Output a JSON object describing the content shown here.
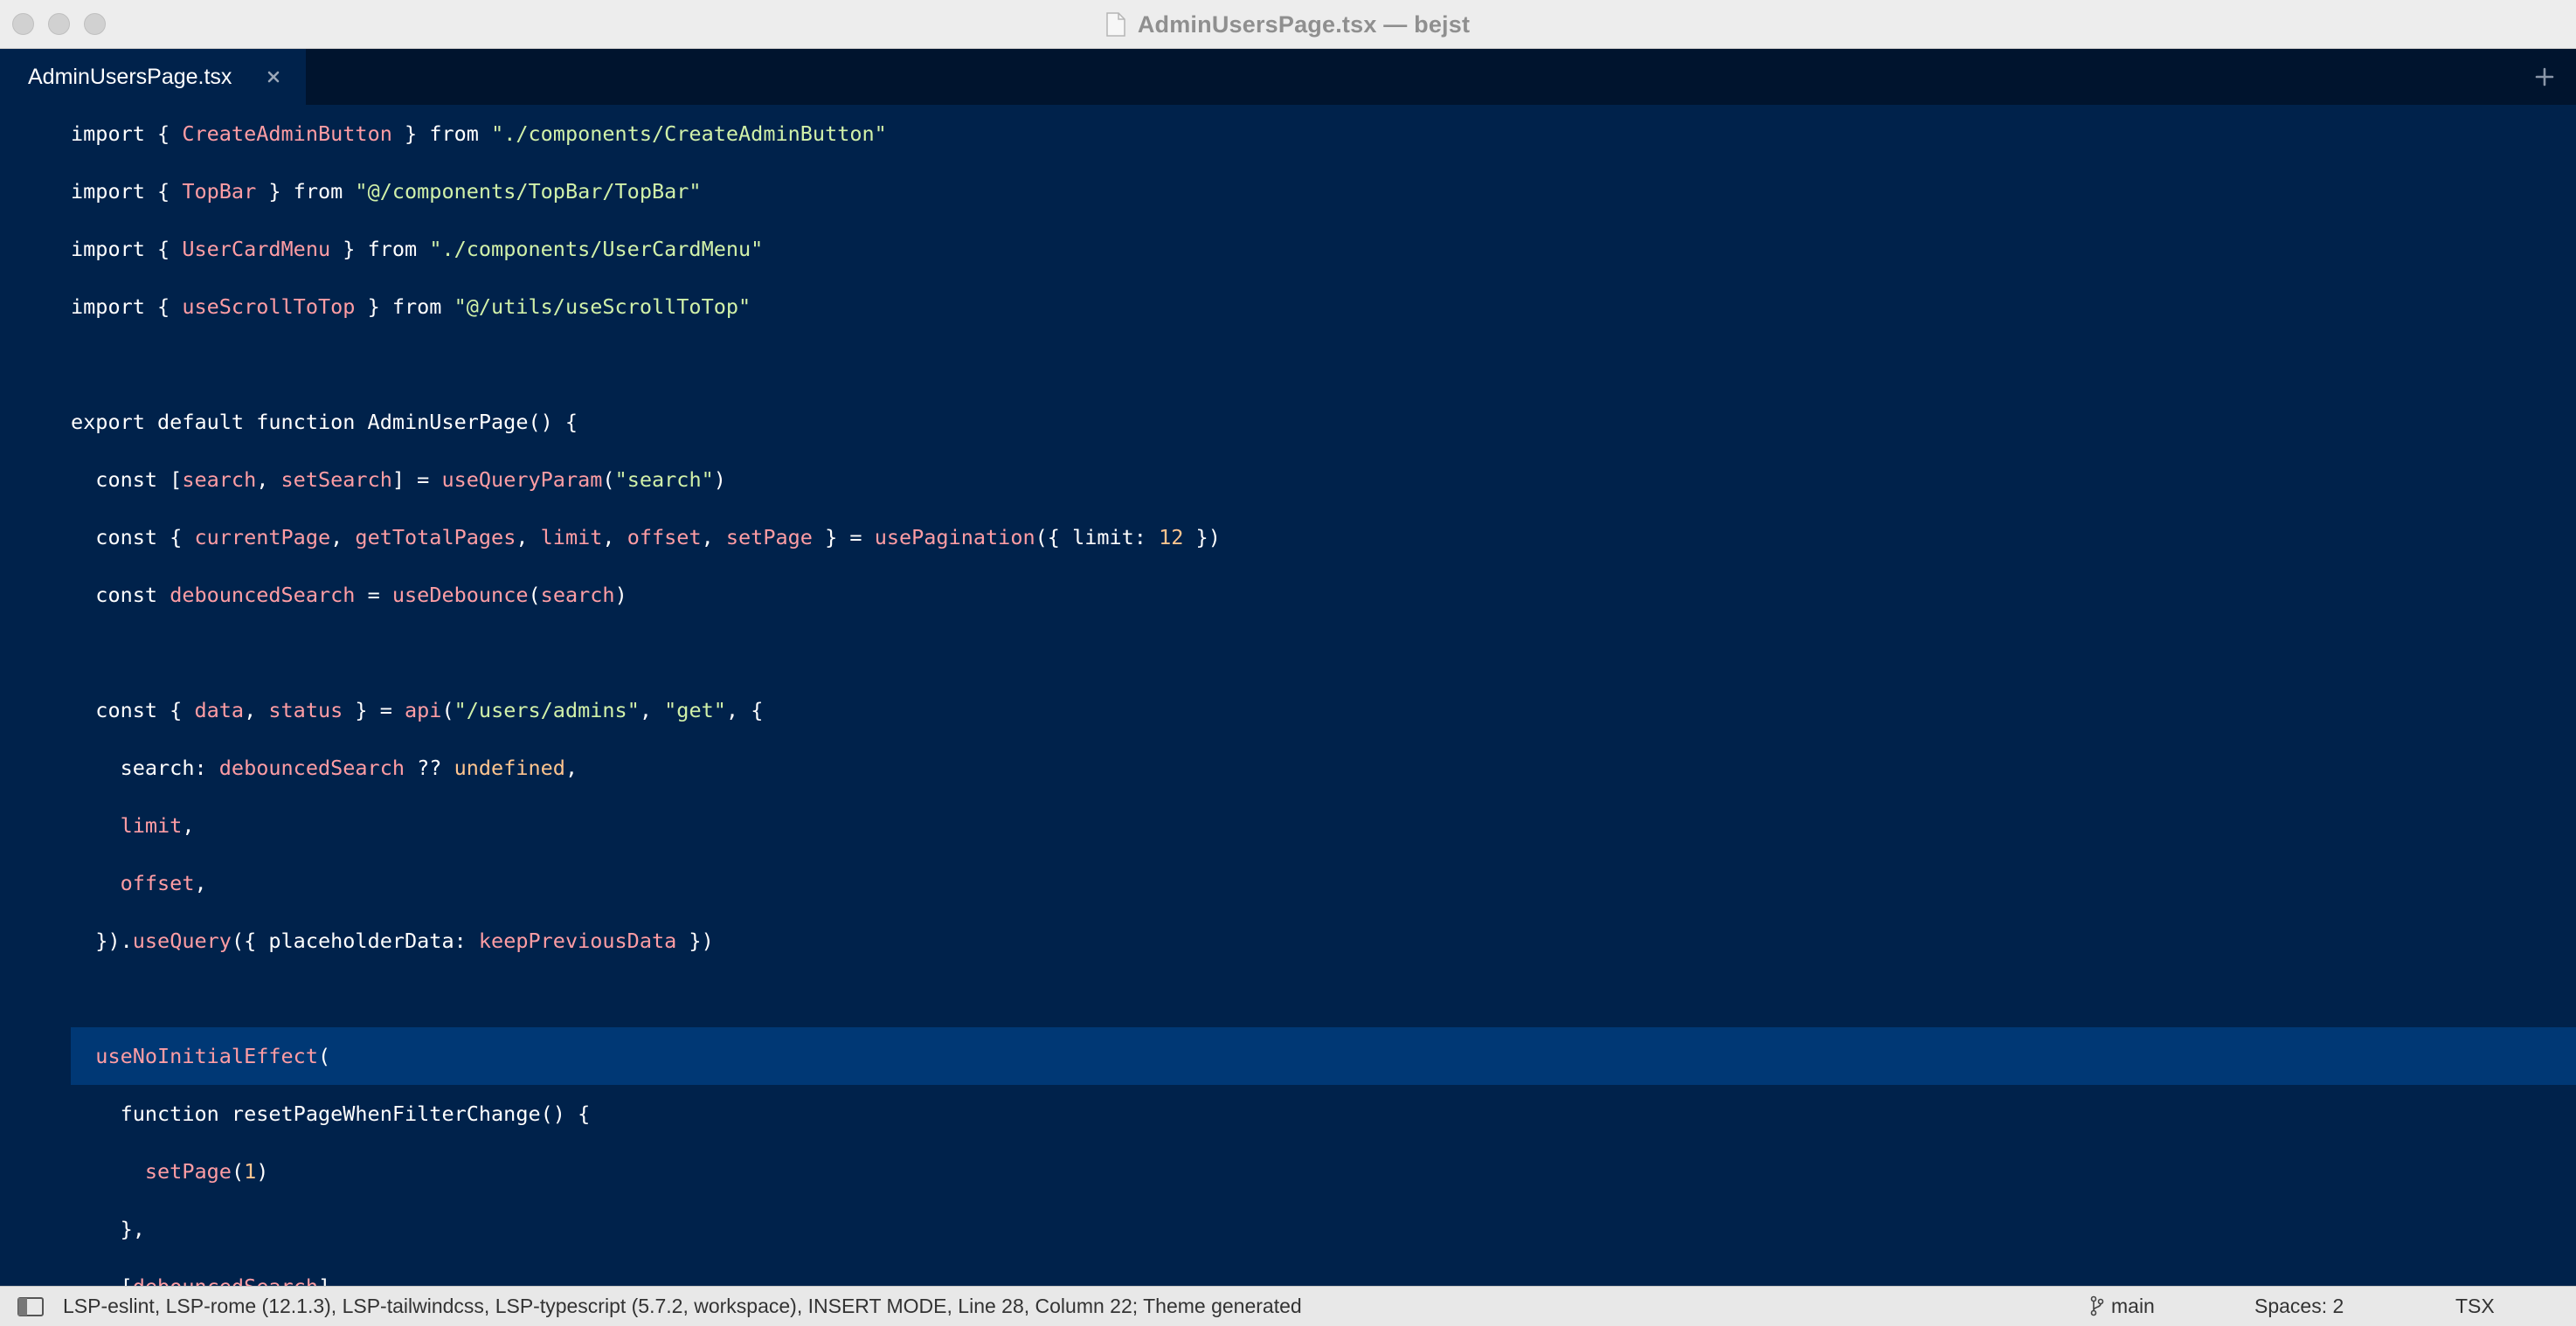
{
  "window": {
    "title": "AdminUsersPage.tsx — bejst"
  },
  "tabs": [
    {
      "label": "AdminUsersPage.tsx",
      "active": true
    }
  ],
  "editor": {
    "current_line_index": 16,
    "colors": {
      "background": "#00224b",
      "current_line": "#003875",
      "plain": "#ffffff",
      "variable": "#ff9da4",
      "string": "#d1f1a9",
      "number": "#ffc58f"
    },
    "lines": [
      [
        [
          "plain",
          "import { "
        ],
        [
          "var",
          "CreateAdminButton"
        ],
        [
          "plain",
          " } from "
        ],
        [
          "str",
          "\"./components/CreateAdminButton\""
        ]
      ],
      [
        [
          "plain",
          "import { "
        ],
        [
          "var",
          "TopBar"
        ],
        [
          "plain",
          " } from "
        ],
        [
          "str",
          "\"@/components/TopBar/TopBar\""
        ]
      ],
      [
        [
          "plain",
          "import { "
        ],
        [
          "var",
          "UserCardMenu"
        ],
        [
          "plain",
          " } from "
        ],
        [
          "str",
          "\"./components/UserCardMenu\""
        ]
      ],
      [
        [
          "plain",
          "import { "
        ],
        [
          "var",
          "useScrollToTop"
        ],
        [
          "plain",
          " } from "
        ],
        [
          "str",
          "\"@/utils/useScrollToTop\""
        ]
      ],
      [],
      [
        [
          "plain",
          "export default function AdminUserPage() {"
        ]
      ],
      [
        [
          "plain",
          "  const ["
        ],
        [
          "var",
          "search"
        ],
        [
          "plain",
          ", "
        ],
        [
          "var",
          "setSearch"
        ],
        [
          "plain",
          "] = "
        ],
        [
          "var",
          "useQueryParam"
        ],
        [
          "plain",
          "("
        ],
        [
          "str",
          "\"search\""
        ],
        [
          "plain",
          ")"
        ]
      ],
      [
        [
          "plain",
          "  const { "
        ],
        [
          "var",
          "currentPage"
        ],
        [
          "plain",
          ", "
        ],
        [
          "var",
          "getTotalPages"
        ],
        [
          "plain",
          ", "
        ],
        [
          "var",
          "limit"
        ],
        [
          "plain",
          ", "
        ],
        [
          "var",
          "offset"
        ],
        [
          "plain",
          ", "
        ],
        [
          "var",
          "setPage"
        ],
        [
          "plain",
          " } = "
        ],
        [
          "var",
          "usePagination"
        ],
        [
          "plain",
          "({ limit: "
        ],
        [
          "num",
          "12"
        ],
        [
          "plain",
          " })"
        ]
      ],
      [
        [
          "plain",
          "  const "
        ],
        [
          "var",
          "debouncedSearch"
        ],
        [
          "plain",
          " = "
        ],
        [
          "var",
          "useDebounce"
        ],
        [
          "plain",
          "("
        ],
        [
          "var",
          "search"
        ],
        [
          "plain",
          ")"
        ]
      ],
      [],
      [
        [
          "plain",
          "  const { "
        ],
        [
          "var",
          "data"
        ],
        [
          "plain",
          ", "
        ],
        [
          "var",
          "status"
        ],
        [
          "plain",
          " } = "
        ],
        [
          "var",
          "api"
        ],
        [
          "plain",
          "("
        ],
        [
          "str",
          "\"/users/admins\""
        ],
        [
          "plain",
          ", "
        ],
        [
          "str",
          "\"get\""
        ],
        [
          "plain",
          ", {"
        ]
      ],
      [
        [
          "plain",
          "    search: "
        ],
        [
          "var",
          "debouncedSearch"
        ],
        [
          "plain",
          " ?? "
        ],
        [
          "num",
          "undefined"
        ],
        [
          "plain",
          ","
        ]
      ],
      [
        [
          "plain",
          "    "
        ],
        [
          "var",
          "limit"
        ],
        [
          "plain",
          ","
        ]
      ],
      [
        [
          "plain",
          "    "
        ],
        [
          "var",
          "offset"
        ],
        [
          "plain",
          ","
        ]
      ],
      [
        [
          "plain",
          "  })."
        ],
        [
          "var",
          "useQuery"
        ],
        [
          "plain",
          "({ placeholderData: "
        ],
        [
          "var",
          "keepPreviousData"
        ],
        [
          "plain",
          " })"
        ]
      ],
      [],
      [
        [
          "plain",
          "  "
        ],
        [
          "var",
          "useNoInitialEffect"
        ],
        [
          "plain",
          "("
        ]
      ],
      [
        [
          "plain",
          "    function resetPageWhenFilterChange() {"
        ]
      ],
      [
        [
          "plain",
          "      "
        ],
        [
          "var",
          "setPage"
        ],
        [
          "plain",
          "("
        ],
        [
          "num",
          "1"
        ],
        [
          "plain",
          ")"
        ]
      ],
      [
        [
          "plain",
          "    },"
        ]
      ],
      [
        [
          "plain",
          "    ["
        ],
        [
          "var",
          "debouncedSearch"
        ],
        [
          "plain",
          "]"
        ]
      ]
    ]
  },
  "statusbar": {
    "text": "LSP-eslint, LSP-rome (12.1.3), LSP-tailwindcss, LSP-typescript (5.7.2, workspace), INSERT MODE, Line 28, Column 22; Theme generated",
    "branch": "main",
    "spaces": "Spaces: 2",
    "syntax": "TSX"
  },
  "icons": [
    "file-icon",
    "close-icon",
    "plus-icon",
    "sidebar-toggle-icon",
    "git-branch-icon"
  ]
}
